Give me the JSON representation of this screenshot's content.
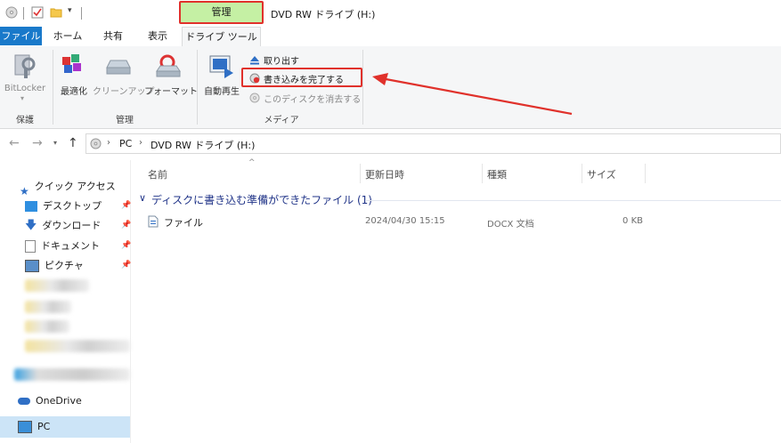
{
  "titlebar": {
    "manage_tab": "管理",
    "window_title": "DVD RW ドライブ (H:)"
  },
  "tabs": {
    "file": "ファイル",
    "home": "ホーム",
    "share": "共有",
    "view": "表示",
    "drive_tools": "ドライブ ツール"
  },
  "ribbon": {
    "bitlocker": "BitLocker",
    "protect_group": "保護",
    "optimize": "最適化",
    "cleanup": "クリーンアップ",
    "format": "フォーマット",
    "manage_group": "管理",
    "autoplay": "自動再生",
    "eject": "取り出す",
    "finish_burning": "書き込みを完了する",
    "erase_disc": "このディスクを消去する",
    "media_group": "メディア"
  },
  "address": {
    "pc": "PC",
    "drive": "DVD RW ドライブ (H:)"
  },
  "nav": {
    "quick_access": "クイック アクセス",
    "desktop": "デスクトップ",
    "downloads": "ダウンロード",
    "documents": "ドキュメント",
    "pictures": "ピクチャ",
    "onedrive": "OneDrive",
    "pc": "PC"
  },
  "columns": {
    "name": "名前",
    "modified": "更新日時",
    "type": "種類",
    "size": "サイズ"
  },
  "group_header": "ディスクに書き込む準備ができたファイル (1)",
  "files": [
    {
      "name": "ファイル",
      "modified": "2024/04/30 15:15",
      "type": "DOCX 文档",
      "size": "0 KB"
    }
  ],
  "colors": {
    "accent": "#1979ca",
    "highlight": "#e0312b",
    "manage_bg": "#c5f0a4"
  }
}
